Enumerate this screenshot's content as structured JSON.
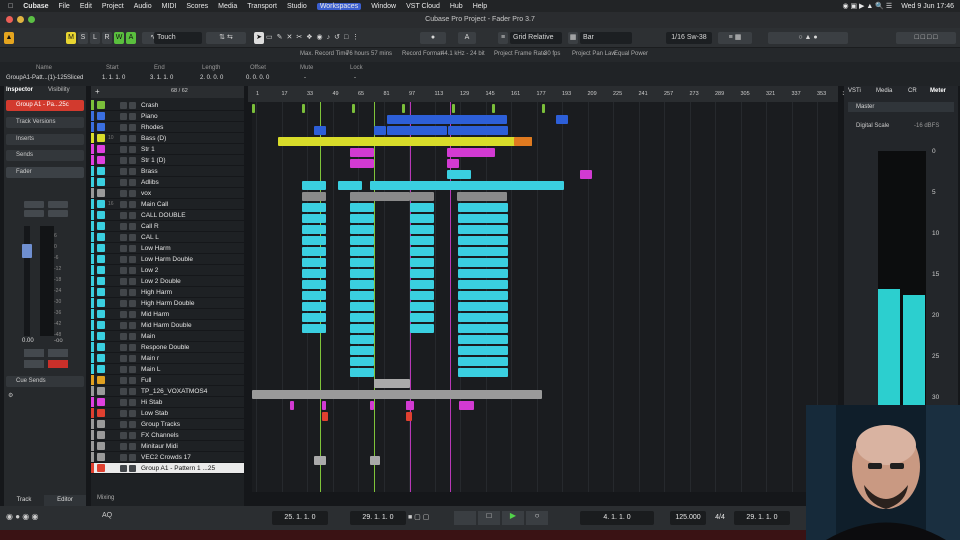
{
  "mac_menu": {
    "items": [
      "Cubase",
      "File",
      "Edit",
      "Project",
      "Audio",
      "MIDI",
      "Scores",
      "Media",
      "Transport",
      "Studio",
      "Workspaces",
      "Window",
      "VST Cloud",
      "Hub",
      "Help"
    ],
    "clock": "Wed 9 Jun  17:46"
  },
  "window_title": "Cubase Pro Project - Fader Pro 3.7",
  "toolbar": {
    "m": "M",
    "s": "S",
    "l": "L",
    "r": "R",
    "w": "W",
    "a": "A",
    "automation_mode": "Touch",
    "snap_type": "Grid Relative",
    "grid": "Bar",
    "quantize": "1/16 Sw-38"
  },
  "infobar": {
    "max_record_label": "Max. Record Time",
    "max_record_value": "76 hours 57 mins",
    "record_format_label": "Record Format",
    "record_format_value": "44.1 kHz - 24 bit",
    "frame_rate_label": "Project Frame Rate",
    "frame_rate_value": "30 fps",
    "pan_law_label": "Project Pan Law",
    "pan_law_value": "Equal Power"
  },
  "event_line": {
    "name_label": "Name",
    "name_value": "GroupA1-Patt...(1)-125Sliced",
    "start_label": "Start",
    "start_value": "1. 1. 1. 0",
    "end_label": "End",
    "end_value": "3. 1. 1. 0",
    "length_label": "Length",
    "length_value": "2. 0. 0. 0",
    "offset_label": "Offset",
    "offset_value": "0. 0. 0. 0",
    "mute_label": "Mute",
    "mute_value": "-",
    "lock_label": "Lock",
    "lock_value": "-"
  },
  "inspector": {
    "tab_inspector": "Inspector",
    "tab_visibility": "Visibility",
    "track_name": "Group A1 - Pa...25c",
    "sections": [
      "Track Versions",
      "Inserts",
      "Sends",
      "Fader"
    ],
    "fader_value": "0.00",
    "pan_value": "-oo",
    "cue_sends": "Cue Sends",
    "bottom_tabs": [
      "Track",
      "Editor"
    ],
    "scale": [
      "6",
      "0",
      "-6",
      "-12",
      "-18",
      "-24",
      "-30",
      "-36",
      "-42",
      "-48"
    ]
  },
  "tracklist": {
    "count": "68 / 62",
    "footer": "Mixing",
    "tracks": [
      {
        "num": "",
        "name": "Crash",
        "color": "#7bbf3a",
        "type": "midi"
      },
      {
        "num": "",
        "name": "Piano",
        "color": "#3b6fe0",
        "type": "midi"
      },
      {
        "num": "",
        "name": "Rhodes",
        "color": "#3b6fe0",
        "type": "midi"
      },
      {
        "num": "10",
        "name": "Bass (D)",
        "color": "#d8dc2a",
        "type": "audio"
      },
      {
        "num": "",
        "name": "Str 1",
        "color": "#e040e0",
        "type": "audio"
      },
      {
        "num": "",
        "name": "Str 1 (D)",
        "color": "#e040e0",
        "type": "audio"
      },
      {
        "num": "",
        "name": "Brass",
        "color": "#3acfe0",
        "type": "midi"
      },
      {
        "num": "",
        "name": "Adlibs",
        "color": "#3acfe0",
        "type": "audio"
      },
      {
        "num": "",
        "name": "vox",
        "color": "#9a9a9a",
        "type": "folder"
      },
      {
        "num": "16",
        "name": "Main Call",
        "color": "#3acfe0",
        "type": "audio"
      },
      {
        "num": "",
        "name": "CALL DOUBLE",
        "color": "#3acfe0",
        "type": "audio"
      },
      {
        "num": "",
        "name": "Call R",
        "color": "#3acfe0",
        "type": "audio"
      },
      {
        "num": "",
        "name": "CAL L",
        "color": "#3acfe0",
        "type": "audio"
      },
      {
        "num": "",
        "name": "Low Harm",
        "color": "#3acfe0",
        "type": "audio"
      },
      {
        "num": "",
        "name": "Low Harm Double",
        "color": "#3acfe0",
        "type": "audio"
      },
      {
        "num": "",
        "name": "Low 2",
        "color": "#3acfe0",
        "type": "audio"
      },
      {
        "num": "",
        "name": "Low 2 Double",
        "color": "#3acfe0",
        "type": "audio"
      },
      {
        "num": "",
        "name": "High Harm",
        "color": "#3acfe0",
        "type": "audio"
      },
      {
        "num": "",
        "name": "High Harm Double",
        "color": "#3acfe0",
        "type": "audio"
      },
      {
        "num": "",
        "name": "Mid Harm",
        "color": "#3acfe0",
        "type": "audio"
      },
      {
        "num": "",
        "name": "Mid Harm Double",
        "color": "#3acfe0",
        "type": "audio"
      },
      {
        "num": "",
        "name": "Main",
        "color": "#3acfe0",
        "type": "audio"
      },
      {
        "num": "",
        "name": "Respone Double",
        "color": "#3acfe0",
        "type": "audio"
      },
      {
        "num": "",
        "name": "Main r",
        "color": "#3acfe0",
        "type": "audio"
      },
      {
        "num": "",
        "name": "Main L",
        "color": "#3acfe0",
        "type": "audio"
      },
      {
        "num": "",
        "name": "Full",
        "color": "#e0a020",
        "type": "audio"
      },
      {
        "num": "",
        "name": "TP_126_VOXATMOS4",
        "color": "#9a9a9a",
        "type": "audio"
      },
      {
        "num": "",
        "name": "Hi Stab",
        "color": "#e040e0",
        "type": "audio"
      },
      {
        "num": "",
        "name": "Low Stab",
        "color": "#e04030",
        "type": "audio"
      },
      {
        "num": "",
        "name": "Group Tracks",
        "color": "#9a9a9a",
        "type": "folder"
      },
      {
        "num": "",
        "name": "FX Channels",
        "color": "#9a9a9a",
        "type": "folder"
      },
      {
        "num": "",
        "name": "Minitaur Midi",
        "color": "#9a9a9a",
        "type": "midi"
      },
      {
        "num": "",
        "name": "VEC2 Crowds 17",
        "color": "#9a9a9a",
        "type": "audio"
      },
      {
        "num": "",
        "name": "Group A1 - Pattern 1 ...25",
        "color": "#e04030",
        "type": "audio"
      }
    ]
  },
  "ruler": [
    "1",
    "17",
    "33",
    "49",
    "65",
    "81",
    "97",
    "113",
    "129",
    "145",
    "161",
    "177",
    "193",
    "209",
    "225",
    "241",
    "257",
    "273",
    "289",
    "305",
    "321",
    "337",
    "353",
    "369"
  ],
  "right_panel": {
    "tabs": [
      "VSTi",
      "Media",
      "CR",
      "Meter"
    ],
    "master": "Master",
    "scale_label": "Digital Scale",
    "scale_value": "-16 dBFS",
    "meter_scale": [
      "0",
      "5",
      "10",
      "15",
      "20",
      "25",
      "30",
      "35",
      "40"
    ],
    "meter_values": {
      "left": 0.57,
      "right": 0.55
    }
  },
  "transport": {
    "left_locator": "25. 1. 1. 0",
    "right_locator": "29. 1. 1. 0",
    "position": "4. 1. 1. 0",
    "tempo": "125.000",
    "signature": "4/4",
    "position2": "29. 1. 1. 0",
    "aq": "AQ"
  }
}
